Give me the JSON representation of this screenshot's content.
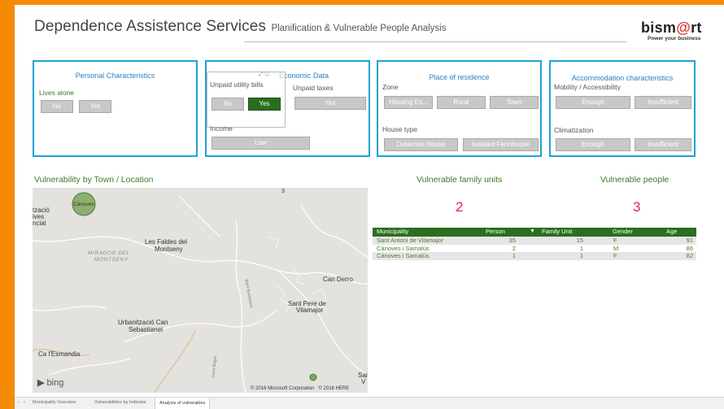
{
  "header": {
    "title": "Dependence Assistence Services",
    "subtitle": "Planification & Vulnerable People Analysis",
    "logo_text_a": "bism",
    "logo_text_at": "@",
    "logo_text_b": "rt",
    "logo_tagline": "Power your business"
  },
  "slicers": {
    "personal": {
      "title": "Personal Characteristics",
      "lives_alone_label": "Lives alone",
      "options": [
        "No",
        "Yes"
      ]
    },
    "economic": {
      "title": "Economic Data",
      "unpaid_bills_label": "Unpaid utility bills",
      "unpaid_bills_options": [
        "No",
        "Yes"
      ],
      "unpaid_bills_selected": "Yes",
      "unpaid_taxes_label": "Unpaid taxes",
      "unpaid_taxes_option": "Yes",
      "income_label": "Income",
      "income_option": "Low"
    },
    "residence": {
      "title": "Place of residence",
      "zone_label": "Zone",
      "zone_options": [
        "Housing Es...",
        "Rural",
        "Town"
      ],
      "house_type_label": "House type",
      "house_type_options": [
        "Detached House",
        "Isolated Farmhouse"
      ]
    },
    "accommodation": {
      "title": "Accommodation characteristics",
      "mobility_label": "Mobility / Accessibility",
      "mobility_options": [
        "Enough",
        "Insufficient"
      ],
      "climatization_label": "Climatization",
      "climatization_options": [
        "Enough",
        "Insufficient"
      ]
    }
  },
  "map": {
    "title": "Vulnerability by Town / Location",
    "bubble_label": "Cànoves",
    "places": [
      "tzació",
      "ives",
      "ncial",
      "Les Faldes del",
      "Montseny",
      "MIRADOR DEL",
      "MONTSENY",
      "Can Derro",
      "Sant Pere de",
      "Vilamajor",
      "Urbanització Can",
      "Sebastianet",
      "Ca l'Esmandia",
      "Sant",
      "V"
    ],
    "road_labels": [
      "Barri Bordoners",
      "Camí Bagas"
    ],
    "road_number": "3",
    "brand": "bing",
    "copyright": "© 2016 Microsoft Corporation   © 2016 HERE"
  },
  "cards": {
    "families_title": "Vulnerable family units",
    "families_value": "2",
    "people_title": "Vulnerable people",
    "people_value": "3"
  },
  "table": {
    "headers": [
      "Municipality",
      "Person",
      "Family Unit",
      "Gender",
      "Age"
    ],
    "rows": [
      [
        "Sant Antoni de Vilamajor",
        "35",
        "15",
        "F",
        "91"
      ],
      [
        "Cànoves i Samalús",
        "2",
        "1",
        "M",
        "86"
      ],
      [
        "Cànoves i Samalús",
        "1",
        "1",
        "F",
        "82"
      ]
    ]
  },
  "tabs": [
    "Municipality Overview",
    "Vulnerabilities by Indicator",
    "Analysis of vulnerables"
  ],
  "colors": {
    "frame": "#f58a07",
    "accent_blue": "#1fa2d8",
    "selected_green": "#2b6e1f",
    "kpi_pink": "#e0255a"
  }
}
